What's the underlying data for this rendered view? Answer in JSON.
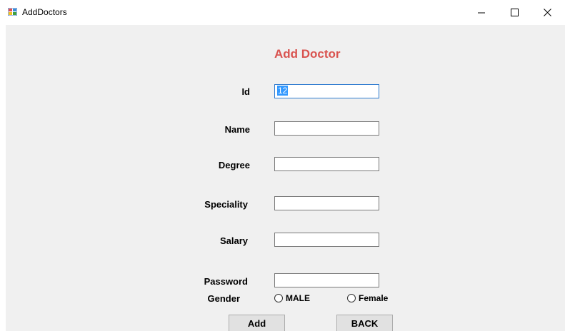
{
  "window": {
    "title": "AddDoctors",
    "minimize_glyph": "—",
    "maximize_glyph": "☐",
    "close_glyph": "✕"
  },
  "form": {
    "title": "Add Doctor",
    "title_color": "#d9534f"
  },
  "fields": {
    "id_label": "Id",
    "id_value": "12",
    "name_label": "Name",
    "name_value": "",
    "degree_label": "Degree",
    "degree_value": "",
    "speciality_label": "Speciality",
    "speciality_value": "",
    "salary_label": "Salary",
    "salary_value": "",
    "password_label": "Password",
    "password_value": ""
  },
  "gender": {
    "label": "Gender",
    "male_label": "MALE",
    "female_label": "Female",
    "selected": ""
  },
  "buttons": {
    "add_label": "Add",
    "back_label": "BACK"
  }
}
